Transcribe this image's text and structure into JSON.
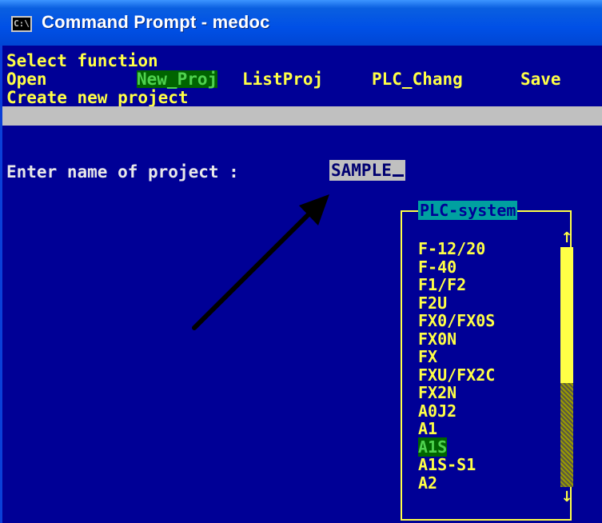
{
  "window": {
    "title": "Command Prompt - medoc",
    "icon_label": "C:\\"
  },
  "console": {
    "line1": "Select function",
    "menu": [
      {
        "label": "Open",
        "highlighted": false
      },
      {
        "label": "New_Proj",
        "highlighted": true
      },
      {
        "label": "ListProj",
        "highlighted": false
      },
      {
        "label": "PLC_Chang",
        "highlighted": false
      },
      {
        "label": "Save",
        "highlighted": false
      }
    ],
    "line3": "Create new project",
    "prompt_label": "Enter name of project :",
    "project_name": "SAMPLE"
  },
  "plc_list": {
    "header": "PLC-system",
    "items": [
      "F-12/20",
      "F-40",
      "F1/F2",
      "F2U",
      "FX0/FX0S",
      "FX0N",
      "FX",
      "FXU/FX2C",
      "FX2N",
      "A0J2",
      "A1",
      "A1S",
      "A1S-S1",
      "A2"
    ],
    "selected": "A1S",
    "scroll_up": "↑",
    "scroll_down": "↓"
  },
  "colors": {
    "background": "#000096",
    "text": "#ffff46",
    "highlight": "#006400",
    "title_bar": "#0050e6"
  }
}
